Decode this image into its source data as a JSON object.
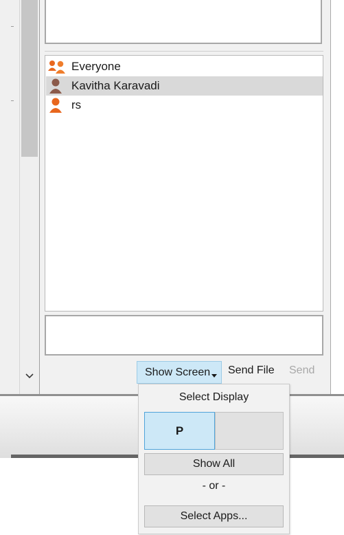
{
  "participants": [
    {
      "name": "Everyone",
      "icon": "group-icon",
      "selected": false
    },
    {
      "name": "Kavitha Karavadi",
      "icon": "user-icon",
      "selected": true
    },
    {
      "name": "rs",
      "icon": "user-icon",
      "selected": false
    }
  ],
  "chat": {
    "input_value": ""
  },
  "toolbar": {
    "show_screen_label": "Show Screen",
    "send_file_label": "Send File",
    "send_label": "Send"
  },
  "screen_menu": {
    "title": "Select Display",
    "displays": [
      {
        "label": "P",
        "selected": true
      },
      {
        "label": "",
        "selected": false
      }
    ],
    "show_all_label": "Show All",
    "or_label": "- or -",
    "select_apps_label": "Select Apps..."
  },
  "colors": {
    "selection": "#d9d9d9",
    "button_active": "#cde8f7",
    "button_active_border": "#4fa3d9",
    "disabled_text": "#a8a8a8",
    "icon_orange": "#e8671e",
    "icon_brown": "#8b5a4a"
  }
}
